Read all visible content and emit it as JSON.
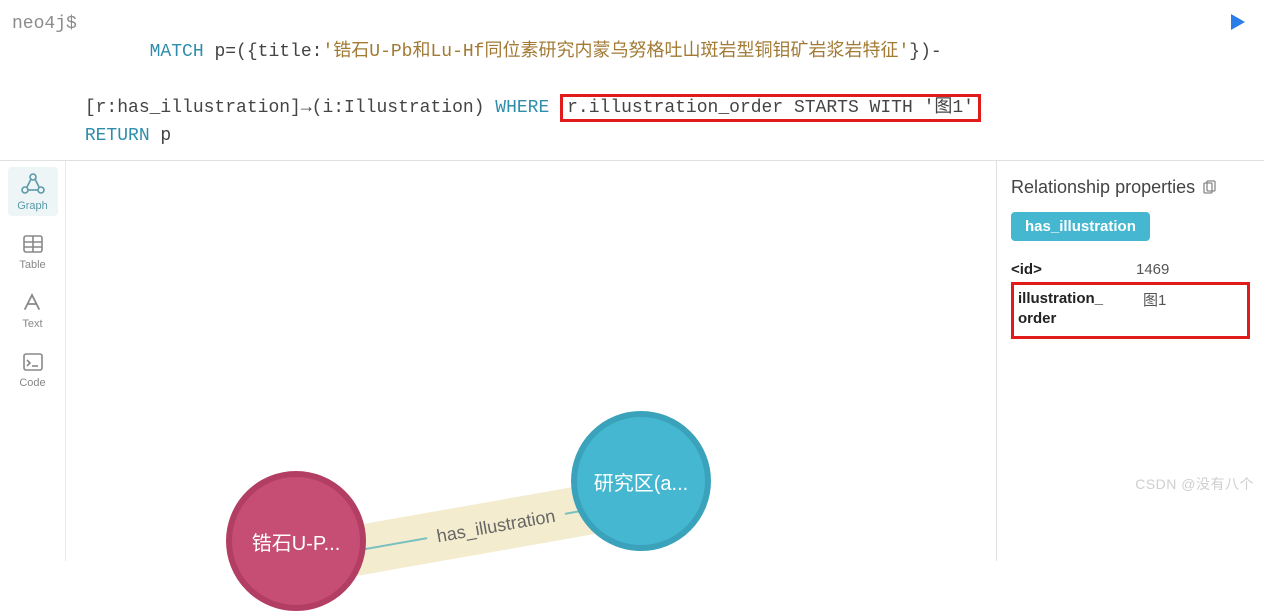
{
  "prompt": "neo4j$",
  "query": {
    "l1": {
      "match": "MATCH",
      "pre": " p=({title:",
      "lit": "'锆石U-Pb和Lu-Hf同位素研究内蒙乌努格吐山斑岩型铜钼矿岩浆岩特征'",
      "post": "})-"
    },
    "l2": {
      "pre": "[r:has_illustration]→(i:Illustration) ",
      "kw": "WHERE",
      "boxed": "r.illustration_order STARTS WITH '图1'"
    },
    "l3": {
      "kw": "RETURN",
      "p": " p"
    }
  },
  "sidebar": {
    "graph": "Graph",
    "table": "Table",
    "text": "Text",
    "code": "Code"
  },
  "graph": {
    "nodeA": "锆石U-P...",
    "nodeB": "研究区(a...",
    "rel": "has_illustration"
  },
  "props": {
    "title": "Relationship properties",
    "badge": "has_illustration",
    "idKey": "<id>",
    "idVal": "1469",
    "orderKey": "illustration_\norder",
    "orderVal": "图1"
  },
  "watermark": "CSDN @没有八个"
}
